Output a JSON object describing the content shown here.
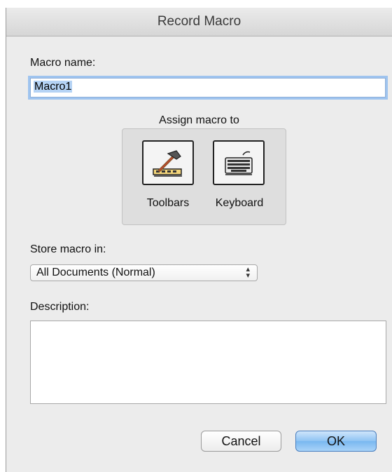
{
  "window": {
    "title": "Record Macro"
  },
  "macro_name": {
    "label": "Macro name:",
    "value": "Macro1"
  },
  "assign": {
    "title": "Assign macro to",
    "toolbars_label": "Toolbars",
    "keyboard_label": "Keyboard"
  },
  "store": {
    "label": "Store macro in:",
    "selected": "All Documents (Normal)"
  },
  "description": {
    "label": "Description:",
    "value": ""
  },
  "buttons": {
    "cancel": "Cancel",
    "ok": "OK"
  },
  "colors": {
    "focus_ring": "#9fc4ef",
    "default_button": "#8ec3f3",
    "window_bg": "#ececec"
  }
}
